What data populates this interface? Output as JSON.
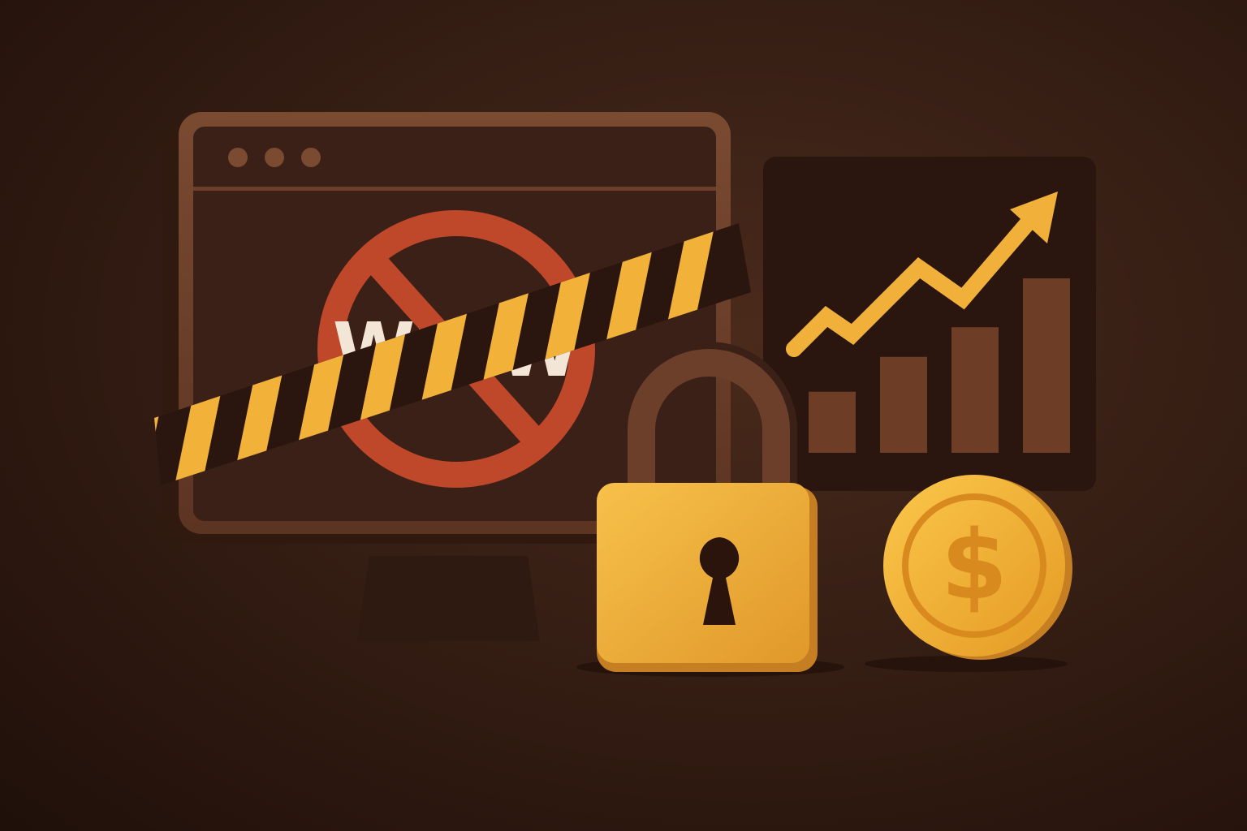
{
  "blocked_site": {
    "label": "WWW"
  },
  "coin": {
    "symbol": "$"
  },
  "trend_chart": {
    "bars_relative": [
      0.35,
      0.55,
      0.72,
      1.0
    ],
    "direction": "up"
  },
  "colors": {
    "background": "#2c1710",
    "monitor_frame": "#6b3f2a",
    "screen": "#3a2016",
    "ban_sign": "#c0482a",
    "tape_yellow": "#f2b23a",
    "tape_dark": "#2a160e",
    "arrow": "#f0b03a",
    "lock_body": "#f0b03a",
    "lock_shackle": "#6b3f2a",
    "coin": "#f2b23a",
    "bars": "#6e3d25"
  }
}
